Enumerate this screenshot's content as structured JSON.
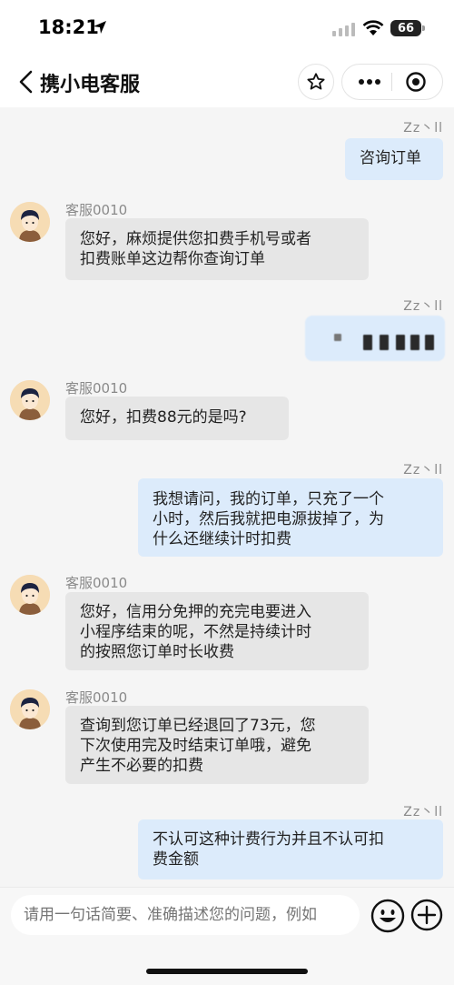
{
  "status_bar": {
    "time": "18:21",
    "battery": "66"
  },
  "header": {
    "title": "携小电客服"
  },
  "messages": [
    {
      "side": "right",
      "text": "咨询订单",
      "status": "Zz丶ll"
    },
    {
      "side": "left",
      "agent": "客服0010",
      "lines": [
        "您好，麻烦提供您扣费手机号或者",
        "扣费账单这边帮你查询订单"
      ]
    },
    {
      "side": "right",
      "text": "",
      "status": "Zz丶ll"
    },
    {
      "side": "left",
      "agent": "客服0010",
      "lines": [
        "您好，扣费88元的是吗?"
      ]
    },
    {
      "side": "right",
      "status": "Zz丶ll",
      "lines": [
        "我想请问，我的订单，只充了一个",
        "小时，然后我就把电源拔掉了，为",
        "什么还继续计时扣费"
      ]
    },
    {
      "side": "left",
      "agent": "客服0010",
      "lines": [
        "您好，信用分免押的充完电要进入",
        "小程序结束的呢，不然是持续计时",
        "的按照您订单时长收费"
      ]
    },
    {
      "side": "left",
      "agent": "客服0010",
      "lines": [
        "查询到您订单已经退回了73元，您",
        "下次使用完及时结束订单哦，避免",
        "产生不必要的扣费"
      ]
    },
    {
      "side": "right",
      "status": "Zz丶ll",
      "lines": [
        "不认可这种计费行为并且不认可扣",
        "费金额"
      ]
    }
  ],
  "input": {
    "placeholder": "请用一句话简要、准确描述您的问题，例如"
  }
}
